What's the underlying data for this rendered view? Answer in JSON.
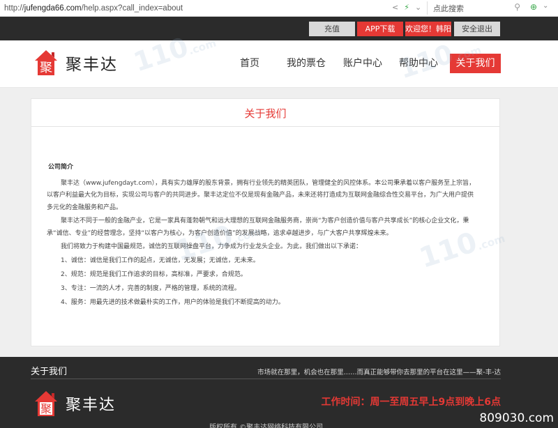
{
  "browser": {
    "url_prefix": "http://",
    "url_domain": "jufengda66.com",
    "url_path": "/help.aspx?call_index=about",
    "search_text": "点此搜索"
  },
  "topbar": {
    "recharge": "充值",
    "app_download": "APP下载",
    "welcome": "欢迎您！韩阳",
    "logout": "安全退出"
  },
  "header": {
    "logo_char": "聚",
    "brand": "聚丰达",
    "nav": {
      "home": "首页",
      "tickets": "我的票仓",
      "account": "账户中心",
      "help": "帮助中心",
      "about": "关于我们"
    }
  },
  "content": {
    "title": "关于我们",
    "subtitle": "公司简介",
    "paragraphs": [
      "聚丰达（www.jufengdayt.com），具有实力雄厚的股东背景，拥有行业领先的精英团队，管理健全的风控体系。本公司秉承着以客户服务至上宗旨，以客户利益最大化为目标，实现公司与客户的共同进步。聚丰达定位不仅是现有金融产品，未来还将打造成为互联网金融综合性交易平台，为广大用户提供多元化的金融服务和产品。",
      "聚丰达不同于一般的金融产业，它是一家具有蓬勃朝气和远大理想的互联网金融服务商，崇尚“为客户创造价值与客户共享成长”的核心企业文化，秉承“诚信、专业”的经营理念，坚持“以客户为核心，为客户创造价值”的发展战略，追求卓越进步，与广大客户共享辉煌未来。",
      "我们将致力于构建中国最规范，诚信的互联网操盘平台，力争成为行业龙头企业。为此，我们做出以下承诺："
    ],
    "items": [
      "1、诚信：诚信是我们工作的起点，无诚信，无发展；无诚信，无未来。",
      "2、规范：规范是我们工作追求的目标，高标准，严要求，合规范。",
      "3、专注：一流的人才，完善的制度，严格的管理，系统的流程。",
      "4、服务：用最先进的技术做最朴实的工作，用户的体验是我们不断提高的动力。"
    ]
  },
  "watermark": {
    "text": "110",
    "suffix": ".com"
  },
  "footer": {
    "title": "关于我们",
    "slogan": "市场就在那里，机会也在那里……而真正能够带你去那里的平台在这里——聚-丰-达",
    "brand": "聚丰达",
    "logo_char": "聚",
    "hours": "工作时间：周一至周五早上9点到晚上6点",
    "copyright": "版权所有 ©聚丰达网络科技有限公司"
  },
  "site_watermark": "809030.com",
  "colors": {
    "accent": "#e53935",
    "dark_bar": "#2b2b2b"
  }
}
